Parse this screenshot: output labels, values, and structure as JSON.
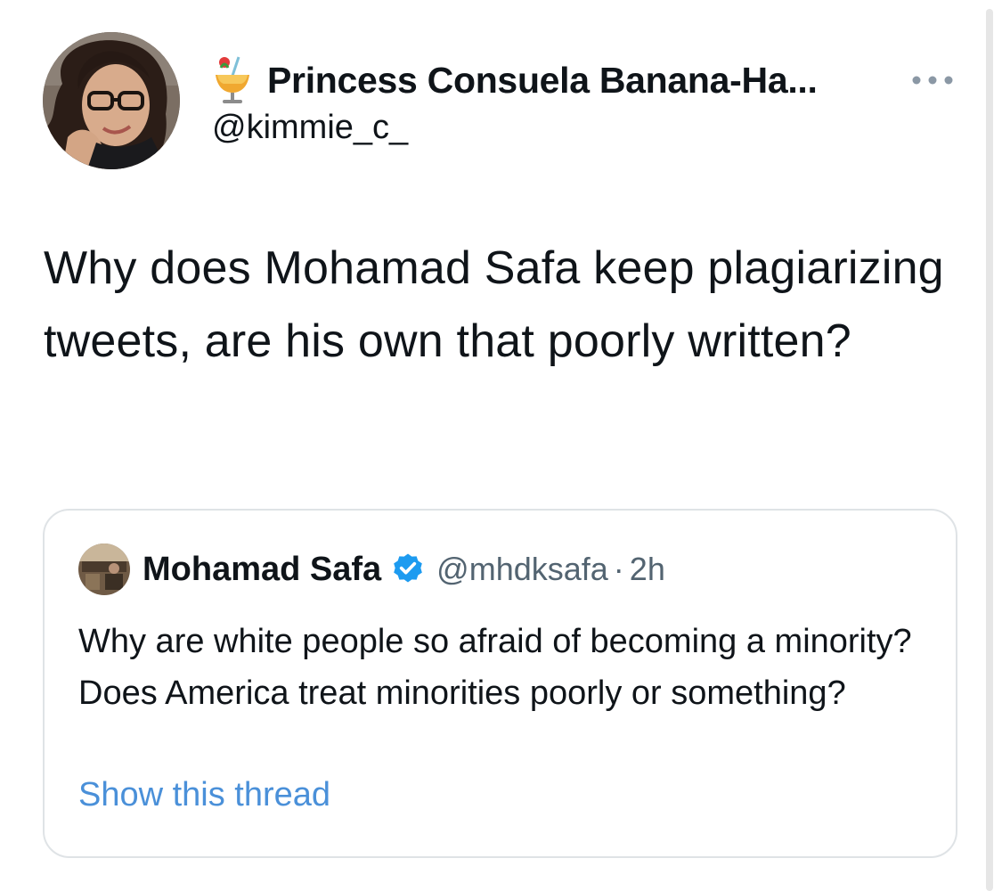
{
  "tweet": {
    "author": {
      "display_name": "Princess Consuela Banana-Ha...",
      "handle": "@kimmie_c_",
      "name_emoji": "tropical-drink-icon",
      "avatar": "profile-photo"
    },
    "more_icon": "more-horizontal-icon",
    "text": "Why does Mohamad Safa keep plagiarizing tweets, are his own that poorly written?"
  },
  "quoted_tweet": {
    "author": {
      "display_name": "Mohamad Safa",
      "handle": "@mhdksafa",
      "verified_icon": "verified-badge-icon",
      "avatar": "profile-photo"
    },
    "separator": "·",
    "time": "2h",
    "text": "Why are white people so afraid of becoming a minority? Does America treat minorities poorly or something?",
    "show_thread_label": "Show this thread"
  },
  "colors": {
    "text": "#0f1419",
    "secondary_text": "#536471",
    "link": "#4a90d9",
    "border": "#dfe3e6",
    "verified": "#1d9bf0",
    "scrollbar": "#e6e6e6"
  }
}
